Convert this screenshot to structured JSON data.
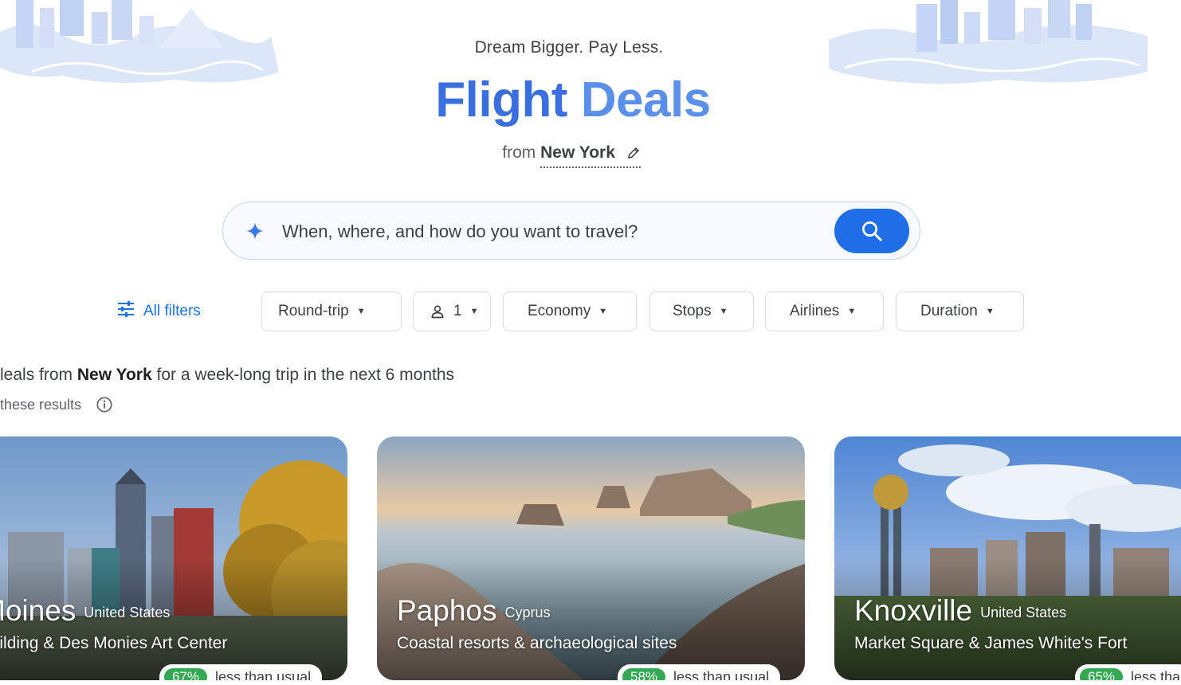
{
  "hero": {
    "tagline": "Dream Bigger. Pay Less.",
    "title_part1": "Flight",
    "title_part2": "Deals",
    "origin_prefix": "from",
    "origin_city": "New York"
  },
  "search": {
    "placeholder": "When, where, and how do you want to travel?"
  },
  "filters": {
    "all_filters_label": "All filters",
    "trip_type": "Round-trip",
    "passengers": "1",
    "cabin_class": "Economy",
    "stops": "Stops",
    "airlines": "Airlines",
    "duration": "Duration"
  },
  "results": {
    "title_prefix": "leals from",
    "title_city": "New York",
    "title_suffix": "for a week-long trip in the next 6 months",
    "subtitle": "these results"
  },
  "deals": [
    {
      "city": "Moines",
      "country": "United States",
      "description": "building & Des Monies Art Center",
      "percent": "67%",
      "badge_text": "less than usual"
    },
    {
      "city": "Paphos",
      "country": "Cyprus",
      "description": "Coastal resorts & archaeological sites",
      "percent": "58%",
      "badge_text": "less than usual"
    },
    {
      "city": "Knoxville",
      "country": "United States",
      "description": "Market Square & James White's Fort",
      "percent": "65%",
      "badge_text": "less tha"
    }
  ],
  "colors": {
    "accent": "#1a73e8",
    "search_button": "#1f6ee8",
    "deal_badge": "#34a853",
    "title_gradient_start": "#3b6fe0",
    "title_gradient_end": "#5a8fea"
  },
  "icons": {
    "sparkle": "sparkle-icon",
    "search": "search-icon",
    "edit": "pencil-icon",
    "filters": "tune-icon",
    "passenger": "person-icon",
    "info": "info-icon"
  }
}
